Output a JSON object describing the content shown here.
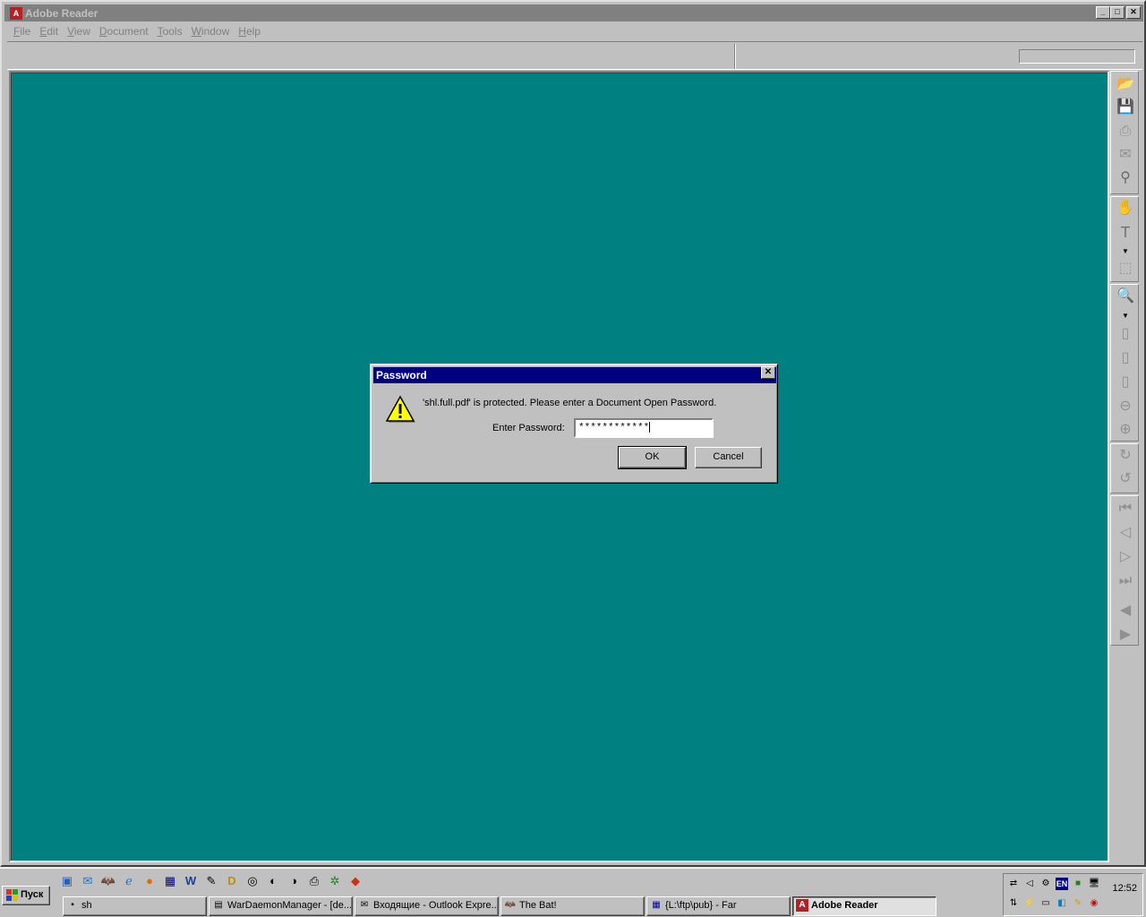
{
  "window": {
    "title": "Adobe Reader"
  },
  "menu": [
    {
      "label": "File",
      "accel": "F",
      "rest": "ile"
    },
    {
      "label": "Edit",
      "accel": "E",
      "rest": "dit"
    },
    {
      "label": "View",
      "accel": "V",
      "rest": "iew"
    },
    {
      "label": "Document",
      "accel": "D",
      "rest": "ocument"
    },
    {
      "label": "Tools",
      "accel": "T",
      "rest": "ools"
    },
    {
      "label": "Window",
      "accel": "W",
      "rest": "indow"
    },
    {
      "label": "Help",
      "accel": "H",
      "rest": "elp"
    }
  ],
  "dialog": {
    "title": "Password",
    "message": "'shl.full.pdf' is protected.  Please enter a Document Open Password.",
    "password_label": "Enter Password:",
    "password_value": "************",
    "ok_label": "OK",
    "cancel_label": "Cancel"
  },
  "taskbar": {
    "start_label": "Пуск",
    "tasks": [
      {
        "label": "sh"
      },
      {
        "label": "WarDaemonManager - [de..."
      },
      {
        "label": "Входящие - Outlook Expre..."
      },
      {
        "label": "The Bat!"
      },
      {
        "label": "{L:\\ftp\\pub} - Far"
      },
      {
        "label": "Adobe Reader"
      }
    ],
    "clock": "12:52",
    "language": "EN"
  },
  "colors": {
    "desktop_teal": "#008080",
    "title_active": "#000080",
    "title_inactive": "#808080"
  }
}
